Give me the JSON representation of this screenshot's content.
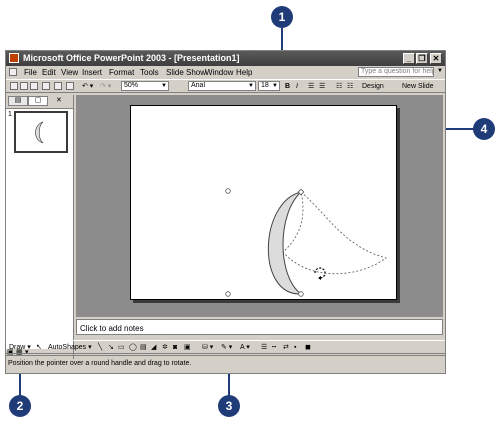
{
  "window": {
    "title": "Microsoft Office PowerPoint 2003 - [Presentation1]",
    "controls": [
      "_",
      "❐",
      "✕"
    ]
  },
  "menu": {
    "items": [
      "File",
      "Edit",
      "View",
      "Insert",
      "Format",
      "Tools",
      "Slide Show",
      "Window",
      "Help"
    ],
    "help_placeholder": "Type a question for help"
  },
  "toolbar": {
    "zoom": "50%",
    "font": "Arial",
    "font_size": "18",
    "bold": "B",
    "italic": "I",
    "design": "Design",
    "new_slide": "New Slide"
  },
  "slides_pane": {
    "close": "✕",
    "slide_number": "1"
  },
  "notes": {
    "placeholder": "Click to add notes"
  },
  "drawing_toolbar": {
    "draw": "Draw",
    "autoshapes": "AutoShapes"
  },
  "status": {
    "text": "Position the pointer over a round handle and drag to rotate."
  },
  "callouts": [
    "1",
    "2",
    "3",
    "4"
  ],
  "colors": {
    "callout": "#1f3b78",
    "moon_fill": "#dcdcdc"
  }
}
